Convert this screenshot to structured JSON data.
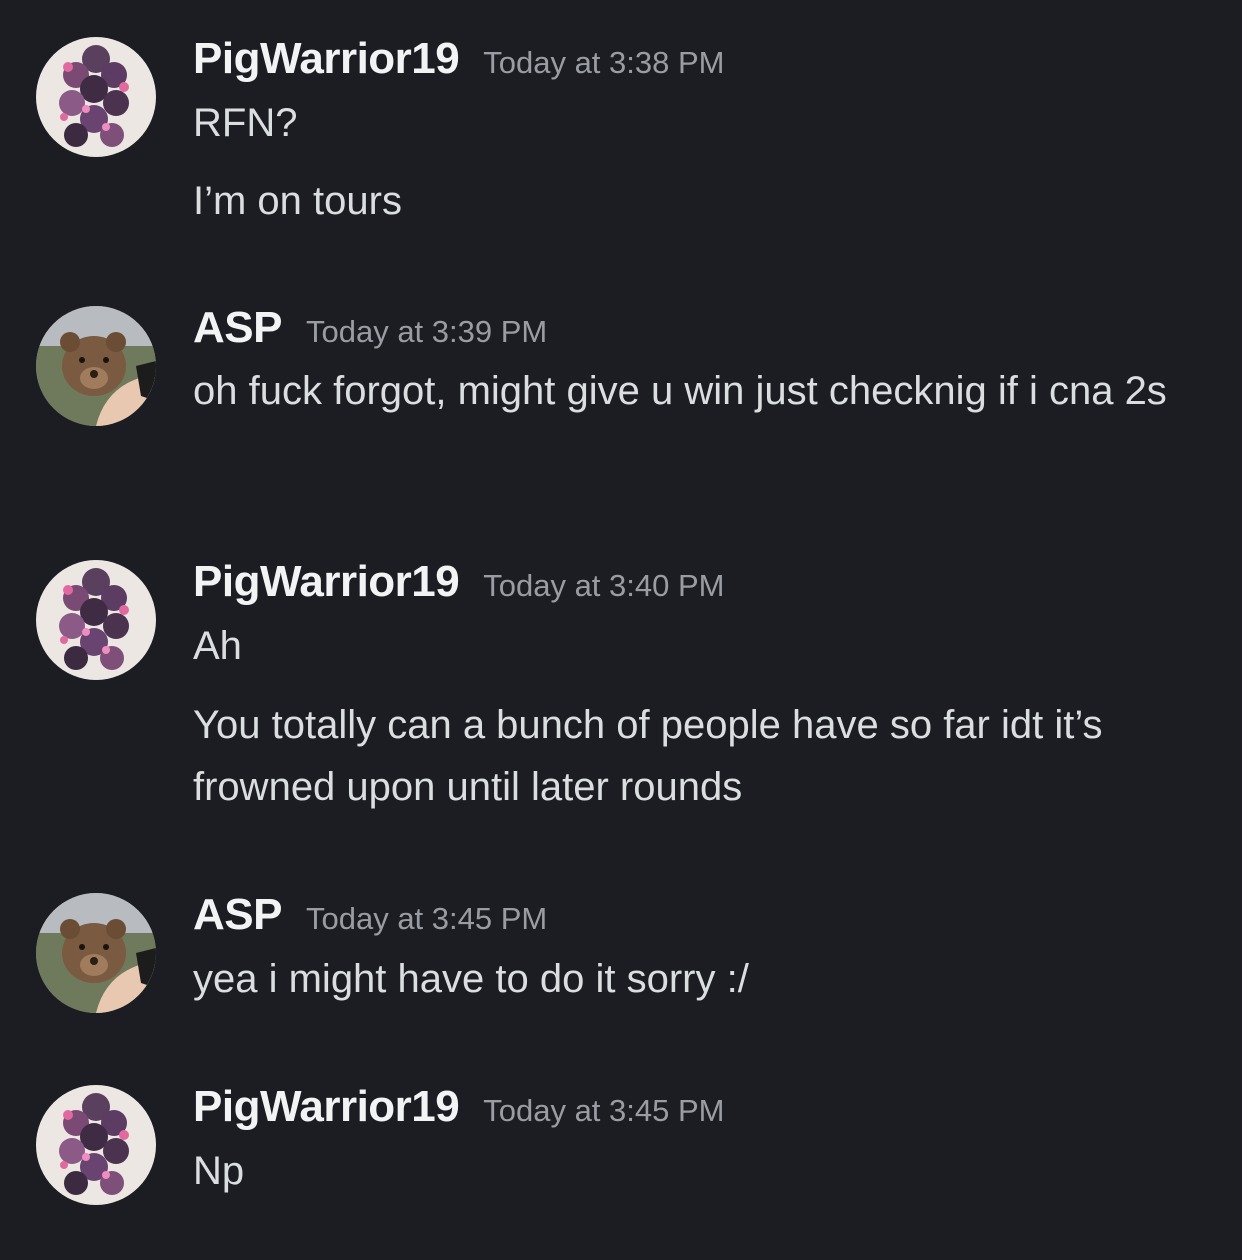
{
  "messages": [
    {
      "username": "PigWarrior19",
      "timestamp": "Today at 3:38 PM",
      "avatar": "pig-stack-avatar",
      "lines": [
        "RFN?",
        "I’m on tours"
      ]
    },
    {
      "username": "ASP",
      "timestamp": "Today at 3:39 PM",
      "avatar": "bear-cub-avatar",
      "lines": [
        "oh fuck forgot, might give u win just checknig if i cna 2s"
      ]
    },
    {
      "username": "PigWarrior19",
      "timestamp": "Today at 3:40 PM",
      "avatar": "pig-stack-avatar",
      "lines": [
        "Ah",
        "You totally can a bunch of people have so far idt it’s frowned upon until later rounds"
      ]
    },
    {
      "username": "ASP",
      "timestamp": "Today at 3:45 PM",
      "avatar": "bear-cub-avatar",
      "lines": [
        "yea i might have to do it sorry :/"
      ]
    },
    {
      "username": "PigWarrior19",
      "timestamp": "Today at 3:45 PM",
      "avatar": "pig-stack-avatar",
      "lines": [
        "Np"
      ]
    }
  ],
  "colors": {
    "background": "#1c1d22",
    "username": "#f2f3f5",
    "timestamp": "#9a9ca3",
    "text": "#dbdee1"
  }
}
